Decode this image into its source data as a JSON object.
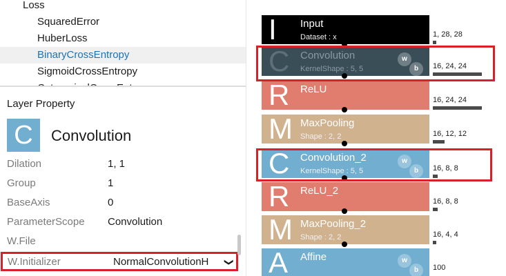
{
  "tree": {
    "items": [
      {
        "label": "Loss",
        "indent": 0,
        "selected": false
      },
      {
        "label": "SquaredError",
        "indent": 1,
        "selected": false
      },
      {
        "label": "HuberLoss",
        "indent": 1,
        "selected": false
      },
      {
        "label": "BinaryCrossEntropy",
        "indent": 1,
        "selected": true
      },
      {
        "label": "SigmoidCrossEntropy",
        "indent": 1,
        "selected": false
      },
      {
        "label": "CategoricalCrossEnt",
        "indent": 1,
        "selected": false
      }
    ]
  },
  "property_panel": {
    "title": "Layer Property",
    "layer_icon_letter": "C",
    "layer_name": "Convolution",
    "rows": [
      {
        "key": "Dilation",
        "value": "1, 1"
      },
      {
        "key": "Group",
        "value": "1"
      },
      {
        "key": "BaseAxis",
        "value": "0"
      },
      {
        "key": "ParameterScope",
        "value": "Convolution"
      },
      {
        "key": "W.File",
        "value": ""
      }
    ],
    "initializer": {
      "key": "W.Initializer",
      "value": "NormalConvolutionH"
    },
    "partial_row": "W.Initializer..."
  },
  "colors": {
    "input": "#000000",
    "conv": "#71aed0",
    "relu": "#e07d6f",
    "pool": "#d0b28f",
    "highlight": "#d8202a",
    "selected_text": "#1a73b8"
  },
  "graph": {
    "layers": [
      {
        "letter": "I",
        "name": "Input",
        "sub": "Dataset : x",
        "kind": "input",
        "shape": "1, 28, 28",
        "wb": false,
        "size_fraction": 0.02
      },
      {
        "letter": "C",
        "name": "Convolution",
        "sub": "KernelShape : 5, 5",
        "kind": "conv_selected",
        "shape": "16, 24, 24",
        "wb": true,
        "size_fraction": 0.98
      },
      {
        "letter": "R",
        "name": "ReLU",
        "sub": "",
        "kind": "relu",
        "shape": "16, 24, 24",
        "wb": false,
        "size_fraction": 0.98
      },
      {
        "letter": "M",
        "name": "MaxPooling",
        "sub": "Shape : 2, 2",
        "kind": "pool",
        "shape": "16, 12, 12",
        "wb": false,
        "size_fraction": 0.24
      },
      {
        "letter": "C",
        "name": "Convolution_2",
        "sub": "KernelShape : 5, 5",
        "kind": "conv",
        "shape": "16, 8, 8",
        "wb": true,
        "size_fraction": 0.1
      },
      {
        "letter": "R",
        "name": "ReLU_2",
        "sub": "",
        "kind": "relu",
        "shape": "16, 8, 8",
        "wb": false,
        "size_fraction": 0.1
      },
      {
        "letter": "M",
        "name": "MaxPooling_2",
        "sub": "Shape : 2, 2",
        "kind": "pool",
        "shape": "16, 4, 4",
        "wb": false,
        "size_fraction": 0.03
      },
      {
        "letter": "A",
        "name": "Affine",
        "sub": "",
        "kind": "conv",
        "shape": "100",
        "wb": true,
        "size_fraction": 0.0
      }
    ],
    "wb_labels": {
      "w": "w",
      "b": "b"
    }
  }
}
